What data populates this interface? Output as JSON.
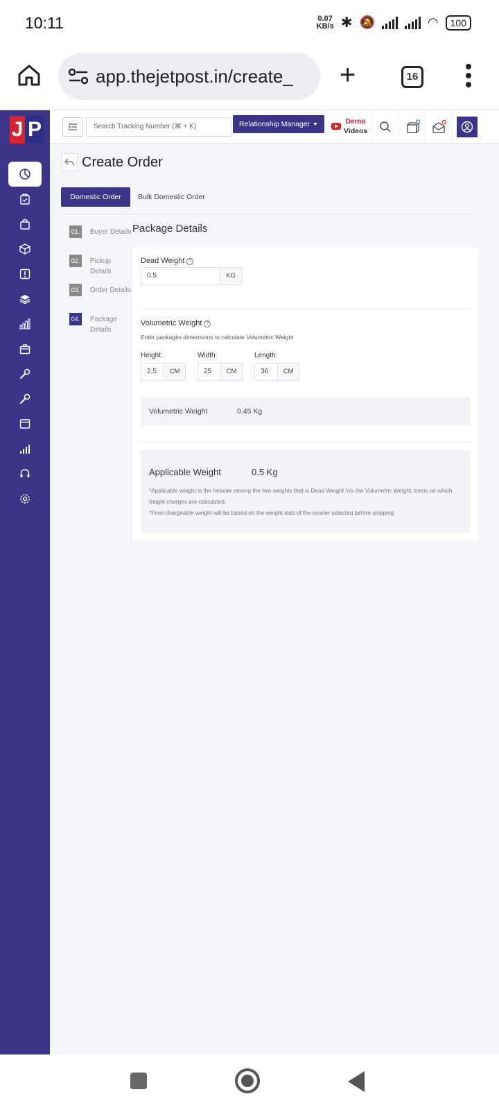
{
  "status_bar": {
    "time": "10:11",
    "net_speed_value": "0.07",
    "net_speed_unit": "KB/s",
    "battery": "100"
  },
  "browser": {
    "url": "app.thejetpost.in/create_",
    "tab_count": "16"
  },
  "sidebar": {
    "logo_left": "J",
    "logo_right": "P",
    "icons": [
      "dashboard-icon",
      "orders-icon",
      "bag-icon",
      "box-icon",
      "alert-icon",
      "layers-icon",
      "chart-icon",
      "briefcase-icon",
      "tools-icon",
      "wrench-icon",
      "window-icon",
      "bar-chart-icon",
      "headset-icon",
      "settings-icon"
    ]
  },
  "topnav": {
    "search_placeholder": "Search Tracking Number (⌘ + K)",
    "rm_label": "Relationship Manager",
    "demo_line1": "Demo",
    "demo_line2": "Videos"
  },
  "page": {
    "title": "Create Order",
    "tabs": [
      "Domestic Order",
      "Bulk Domestic Order"
    ],
    "steps": [
      {
        "num": "01.",
        "label": "Buyer Details"
      },
      {
        "num": "02.",
        "label": "Pickup Details"
      },
      {
        "num": "03.",
        "label": "Order Details"
      },
      {
        "num": "04.",
        "label": "Package Details"
      }
    ]
  },
  "package": {
    "section_title": "Package Details",
    "dead_weight_label": "Dead Weight",
    "dead_weight_value": "0.5",
    "dead_weight_unit": "KG",
    "volumetric_label": "Volumetric Weight",
    "volumetric_hint": "Enter packages dimensions to calculate Volumetric Weight",
    "height_label": "Height:",
    "height_value": "2.5",
    "width_label": "Width:",
    "width_value": "25",
    "length_label": "Length:",
    "length_value": "36",
    "dim_unit": "CM",
    "vol_result_label": "Volumetric Weight",
    "vol_result_value": "0.45 Kg",
    "applicable_label": "Applicable Weight",
    "applicable_value": "0.5 Kg",
    "note1": "*Applicable weight is the heavier among the two weights that is Dead Weight V/s the Volumetric Weight, basis on which freight charges are calculated.",
    "note2": "*Final chargeable weight will be based on the weight slab of the courier selected before shipping"
  },
  "colors": {
    "primary": "#3b3488",
    "logo_red": "#d62430",
    "page_bg": "#f4f5f9"
  }
}
